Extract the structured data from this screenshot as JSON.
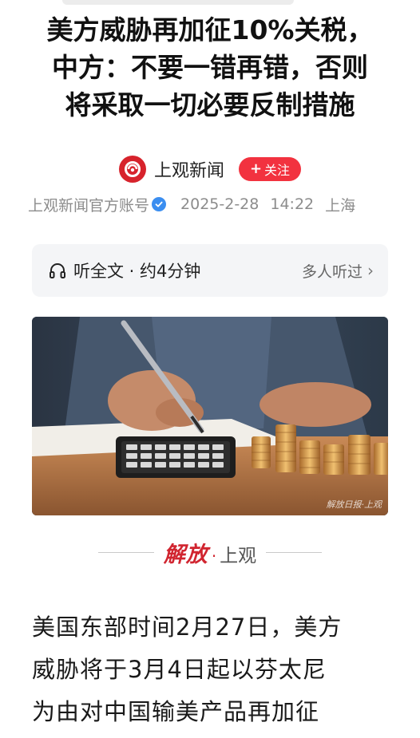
{
  "headline": {
    "line1": "美方威胁再加征10%关税，",
    "line2": "中方：不要一错再错，否则",
    "line3": "将采取一切必要反制措施"
  },
  "source": {
    "name": "上观新闻",
    "follow_label": "关注",
    "follow_plus": "+",
    "logo_icon": "shangguan-logo-icon",
    "brand_color": "#d7232c"
  },
  "meta": {
    "account": "上观新闻官方账号",
    "date": "2025-2-28",
    "time": "14:22",
    "location": "上海"
  },
  "listen": {
    "label": "听全文 · 约4分钟",
    "listeners": "多人听过",
    "chevron": "›"
  },
  "hero": {
    "watermark": "解放日报·上观"
  },
  "brand": {
    "script": "解放",
    "dot": "·",
    "name": "上观"
  },
  "body": {
    "line1": "美国东部时间2月27日，美方",
    "line2": "威胁将于3月4日起以芬太尼",
    "line3": "为由对中国输美产品再加征"
  }
}
